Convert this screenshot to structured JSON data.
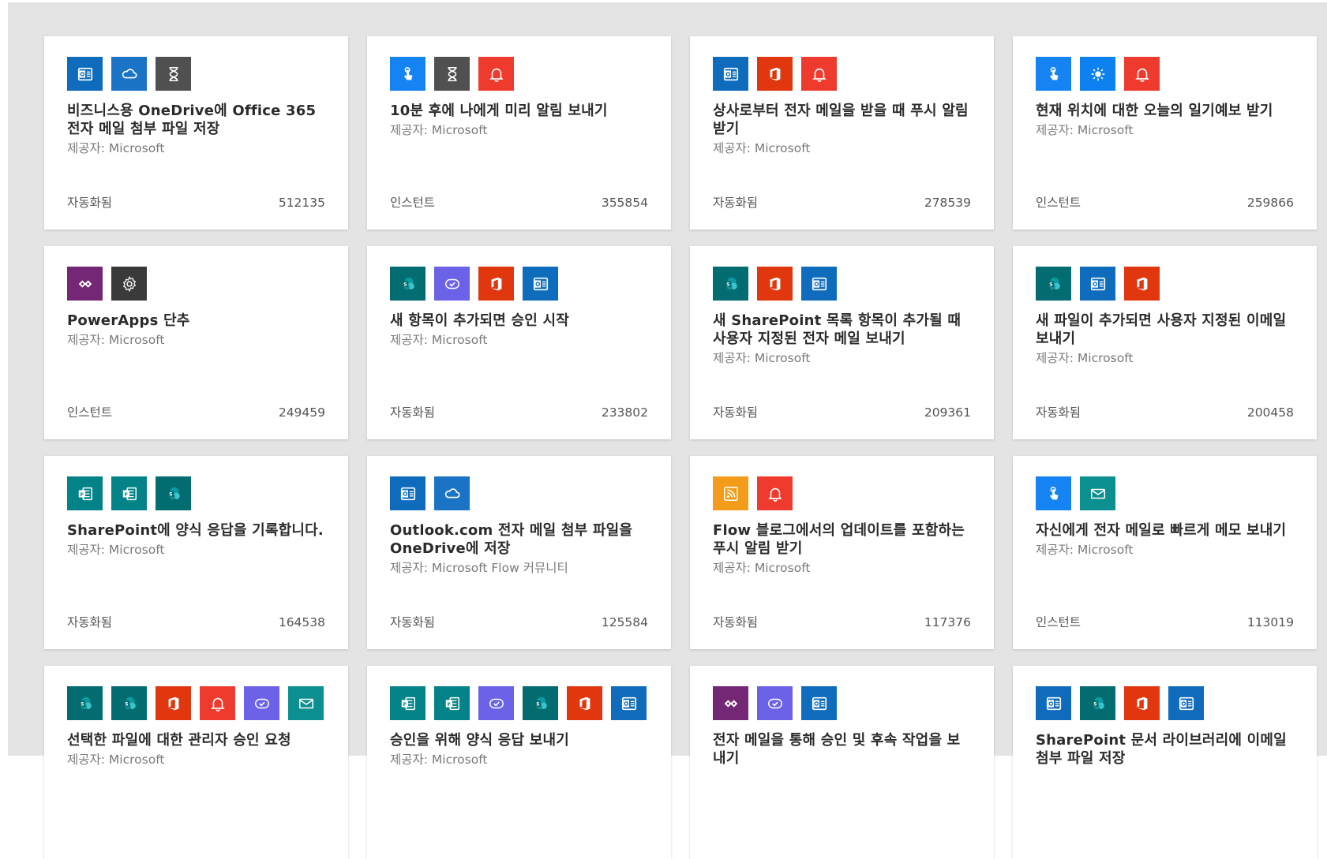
{
  "colors": {
    "outlook": "#0f6cbd",
    "onedrive": "#1b73c6",
    "timer": "#505050",
    "button": "#1683f2",
    "notification": "#ef3b2d",
    "office365": "#e1370f",
    "weather": "#0d81ef",
    "powerapps": "#742774",
    "settings": "#3a3a3a",
    "sharepoint": "#036c70",
    "approvals": "#6b62e8",
    "forms": "#038387",
    "rss": "#f39c1a",
    "mail": "#0c8f8f"
  },
  "cards": [
    {
      "icons": [
        "outlook-icon",
        "onedrive-icon",
        "timer-icon"
      ],
      "title": "비즈니스용 OneDrive에 Office 365 전자 메일 첨부 파일 저장",
      "provider": "제공자: Microsoft",
      "type": "자동화됨",
      "count": "512135"
    },
    {
      "icons": [
        "button-icon",
        "timer-icon",
        "notification-icon"
      ],
      "title": "10분 후에 나에게 미리 알림 보내기",
      "provider": "제공자: Microsoft",
      "type": "인스턴트",
      "count": "355854"
    },
    {
      "icons": [
        "outlook-icon",
        "office365-icon",
        "notification-icon"
      ],
      "title": "상사로부터 전자 메일을 받을 때 푸시 알림 받기",
      "provider": "제공자: Microsoft",
      "type": "자동화됨",
      "count": "278539"
    },
    {
      "icons": [
        "button-icon",
        "weather-icon",
        "notification-icon"
      ],
      "title": "현재 위치에 대한 오늘의 일기예보 받기",
      "provider": "제공자: Microsoft",
      "type": "인스턴트",
      "count": "259866"
    },
    {
      "icons": [
        "powerapps-icon",
        "settings-icon"
      ],
      "title": "PowerApps 단추",
      "provider": "제공자: Microsoft",
      "type": "인스턴트",
      "count": "249459"
    },
    {
      "icons": [
        "sharepoint-icon",
        "approvals-icon",
        "office365-icon",
        "outlook-icon"
      ],
      "title": "새 항목이 추가되면 승인 시작",
      "provider": "제공자: Microsoft",
      "type": "자동화됨",
      "count": "233802"
    },
    {
      "icons": [
        "sharepoint-icon",
        "office365-icon",
        "outlook-icon"
      ],
      "title": "새 SharePoint 목록 항목이 추가될 때 사용자 지정된 전자 메일 보내기",
      "provider": "제공자: Microsoft",
      "type": "자동화됨",
      "count": "209361"
    },
    {
      "icons": [
        "sharepoint-icon",
        "outlook-icon",
        "office365-icon"
      ],
      "title": "새 파일이 추가되면 사용자 지정된 이메일 보내기",
      "provider": "제공자: Microsoft",
      "type": "자동화됨",
      "count": "200458"
    },
    {
      "icons": [
        "forms-icon",
        "forms-icon",
        "sharepoint-icon"
      ],
      "title": "SharePoint에 양식 응답을 기록합니다.",
      "provider": "제공자: Microsoft",
      "type": "자동화됨",
      "count": "164538"
    },
    {
      "icons": [
        "outlook-icon",
        "onedrive-icon"
      ],
      "title": "Outlook.com 전자 메일 첨부 파일을 OneDrive에 저장",
      "provider": "제공자: Microsoft Flow 커뮤니티",
      "type": "자동화됨",
      "count": "125584"
    },
    {
      "icons": [
        "rss-icon",
        "notification-icon"
      ],
      "title": "Flow 블로그에서의 업데이트를 포함하는 푸시 알림 받기",
      "provider": "제공자: Microsoft",
      "type": "자동화됨",
      "count": "117376"
    },
    {
      "icons": [
        "button-icon",
        "mail-icon"
      ],
      "title": "자신에게 전자 메일로 빠르게 메모 보내기",
      "provider": "제공자: Microsoft",
      "type": "인스턴트",
      "count": "113019"
    },
    {
      "icons": [
        "sharepoint-icon",
        "sharepoint-icon",
        "office365-icon",
        "notification-icon",
        "approvals-icon",
        "mail-icon"
      ],
      "title": "선택한 파일에 대한 관리자 승인 요청",
      "provider": "제공자: Microsoft",
      "type": "",
      "count": ""
    },
    {
      "icons": [
        "forms-icon",
        "forms-icon",
        "approvals-icon",
        "sharepoint-icon",
        "office365-icon",
        "outlook-icon"
      ],
      "title": "승인을 위해 양식 응답 보내기",
      "provider": "제공자: Microsoft",
      "type": "",
      "count": ""
    },
    {
      "icons": [
        "powerapps-icon",
        "approvals-icon",
        "outlook-icon"
      ],
      "title": "전자 메일을 통해 승인 및 후속 작업을 보내기",
      "provider": "",
      "type": "",
      "count": ""
    },
    {
      "icons": [
        "outlook-icon",
        "sharepoint-icon",
        "office365-icon",
        "outlook-icon"
      ],
      "title": "SharePoint 문서 라이브러리에 이메일 첨부 파일 저장",
      "provider": "",
      "type": "",
      "count": ""
    }
  ]
}
